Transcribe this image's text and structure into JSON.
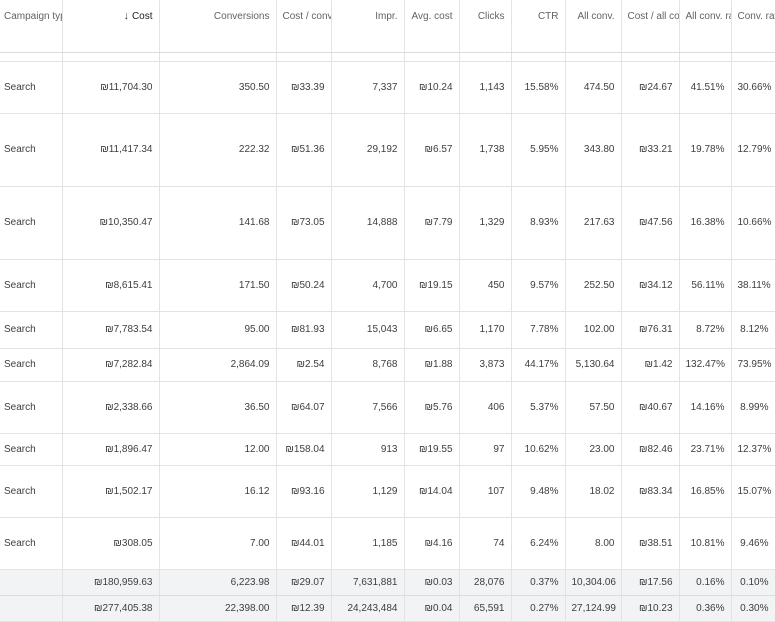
{
  "headers": [
    {
      "label": "Campaign type",
      "align": "txt"
    },
    {
      "label": "Cost",
      "align": "num",
      "sorted": true,
      "sort_icon": "arrow-down-icon",
      "sort_glyph": "↓"
    },
    {
      "label": "Conversions",
      "align": "num"
    },
    {
      "label": "Cost / conv.",
      "align": "num"
    },
    {
      "label": "Impr.",
      "align": "num"
    },
    {
      "label": "Avg. cost",
      "align": "num"
    },
    {
      "label": "Clicks",
      "align": "num"
    },
    {
      "label": "CTR",
      "align": "num"
    },
    {
      "label": "All conv.",
      "align": "num"
    },
    {
      "label": "Cost / all conv.",
      "align": "num"
    },
    {
      "label": "All conv. rate",
      "align": "num"
    },
    {
      "label": "Conv. rate",
      "align": "num"
    }
  ],
  "rows": [
    [
      "Search",
      "₪11,704.30",
      "350.50",
      "₪33.39",
      "7,337",
      "₪10.24",
      "1,143",
      "15.58%",
      "474.50",
      "₪24.67",
      "41.51%",
      "30.66%"
    ],
    [
      "Search",
      "₪11,417.34",
      "222.32",
      "₪51.36",
      "29,192",
      "₪6.57",
      "1,738",
      "5.95%",
      "343.80",
      "₪33.21",
      "19.78%",
      "12.79%"
    ],
    [
      "Search",
      "₪10,350.47",
      "141.68",
      "₪73.05",
      "14,888",
      "₪7.79",
      "1,329",
      "8.93%",
      "217.63",
      "₪47.56",
      "16.38%",
      "10.66%"
    ],
    [
      "Search",
      "₪8,615.41",
      "171.50",
      "₪50.24",
      "4,700",
      "₪19.15",
      "450",
      "9.57%",
      "252.50",
      "₪34.12",
      "56.11%",
      "38.11%"
    ],
    [
      "Search",
      "₪7,783.54",
      "95.00",
      "₪81.93",
      "15,043",
      "₪6.65",
      "1,170",
      "7.78%",
      "102.00",
      "₪76.31",
      "8.72%",
      "8.12%"
    ],
    [
      "Search",
      "₪7,282.84",
      "2,864.09",
      "₪2.54",
      "8,768",
      "₪1.88",
      "3,873",
      "44.17%",
      "5,130.64",
      "₪1.42",
      "132.47%",
      "73.95%"
    ],
    [
      "Search",
      "₪2,338.66",
      "36.50",
      "₪64.07",
      "7,566",
      "₪5.76",
      "406",
      "5.37%",
      "57.50",
      "₪40.67",
      "14.16%",
      "8.99%"
    ],
    [
      "Search",
      "₪1,896.47",
      "12.00",
      "₪158.04",
      "913",
      "₪19.55",
      "97",
      "10.62%",
      "23.00",
      "₪82.46",
      "23.71%",
      "12.37%"
    ],
    [
      "Search",
      "₪1,502.17",
      "16.12",
      "₪93.16",
      "1,129",
      "₪14.04",
      "107",
      "9.48%",
      "18.02",
      "₪83.34",
      "16.85%",
      "15.07%"
    ],
    [
      "Search",
      "₪308.05",
      "7.00",
      "₪44.01",
      "1,185",
      "₪4.16",
      "74",
      "6.24%",
      "8.00",
      "₪38.51",
      "10.81%",
      "9.46%"
    ]
  ],
  "totals": [
    [
      "",
      "₪180,959.63",
      "6,223.98",
      "₪29.07",
      "7,631,881",
      "₪0.03",
      "28,076",
      "0.37%",
      "10,304.06",
      "₪17.56",
      "0.16%",
      "0.10%"
    ],
    [
      "",
      "₪277,405.38",
      "22,398.00",
      "₪12.39",
      "24,243,484",
      "₪0.04",
      "65,591",
      "0.27%",
      "27,124.99",
      "₪10.23",
      "0.36%",
      "0.30%"
    ]
  ]
}
